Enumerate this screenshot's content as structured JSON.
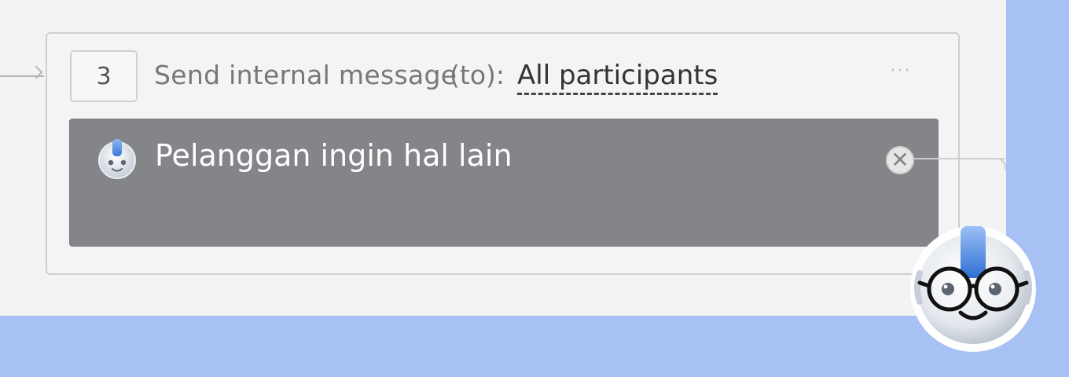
{
  "step": {
    "number": "3",
    "title": "Send internal message",
    "to_label": "(to):",
    "recipient": "All participants",
    "more_icon": "ellipsis-icon",
    "more_text": "···"
  },
  "message": {
    "avatar_icon": "robot-avatar-icon",
    "text": "Pelanggan ingin hal lain",
    "remove_icon": "close-circle-icon",
    "remove_text": "✕"
  },
  "mascot": {
    "icon": "robot-mascot-icon"
  },
  "colors": {
    "canvas_background": "#a7c1f4",
    "workspace_background": "#f3f3f3",
    "message_background": "#848589",
    "accent_blue": "#4a86e0"
  }
}
